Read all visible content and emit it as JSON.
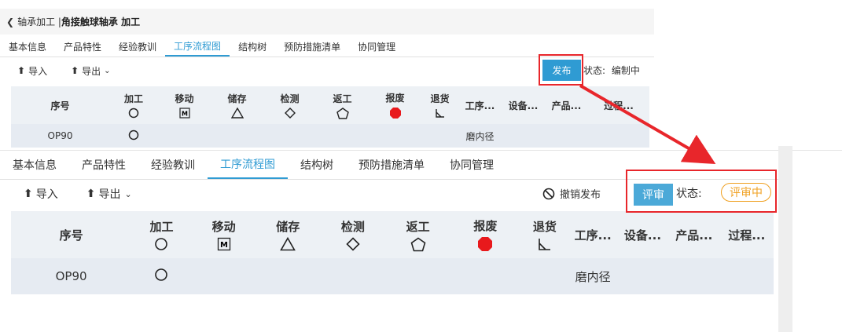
{
  "breadcrumb": {
    "back": "轴承加工 |",
    "title": "角接触球轴承 加工"
  },
  "tabs": [
    "基本信息",
    "产品特性",
    "经验教训",
    "工序流程图",
    "结构树",
    "预防措施清单",
    "协同管理"
  ],
  "active_tab": "工序流程图",
  "toolbar": {
    "import": "导入",
    "export": "导出",
    "dropdown_caret": "chevron-down-icon"
  },
  "top": {
    "publish": "发布",
    "status_label": "状态:",
    "status_value": "编制中"
  },
  "bottom": {
    "revoke": "撤销发布",
    "review": "评审",
    "status_label": "状态:",
    "status_value": "评审中"
  },
  "table": {
    "headers": [
      {
        "key": "seq",
        "label": "序号"
      },
      {
        "key": "proc",
        "label": "加工",
        "icon": "circle"
      },
      {
        "key": "move",
        "label": "移动",
        "icon": "m-box"
      },
      {
        "key": "store",
        "label": "储存",
        "icon": "triangle"
      },
      {
        "key": "check",
        "label": "检测",
        "icon": "diamond"
      },
      {
        "key": "rework",
        "label": "返工",
        "icon": "pentagon"
      },
      {
        "key": "scrap",
        "label": "报废",
        "icon": "red-octagon"
      },
      {
        "key": "return",
        "label": "退货",
        "icon": "return-mark"
      },
      {
        "key": "op",
        "label": "工序..."
      },
      {
        "key": "equip",
        "label": "设备..."
      },
      {
        "key": "prod",
        "label": "产品..."
      },
      {
        "key": "procstep",
        "label": "过程..."
      }
    ],
    "rows": [
      {
        "seq": "OP90",
        "proc_marker": "circle",
        "op": "磨内径"
      }
    ]
  },
  "colors": {
    "accent": "#2f9bd3",
    "highlight": "#e8262b",
    "review_badge": "#f0a020",
    "scrap": "#e8191c"
  }
}
